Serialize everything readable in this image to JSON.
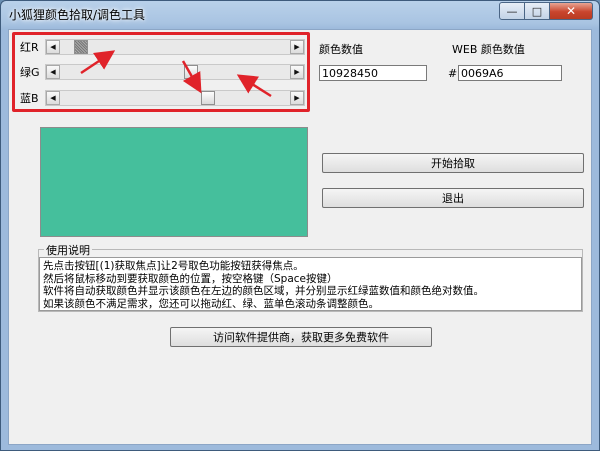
{
  "window": {
    "title": "小狐狸颜色拾取/调色工具",
    "minimize": "—",
    "maximize": "□",
    "close": "✕"
  },
  "sliders": [
    {
      "label": "红R",
      "value": 16,
      "max": 255
    },
    {
      "label": "绿G",
      "value": 146,
      "max": 255
    },
    {
      "label": "蓝B",
      "value": 166,
      "max": 255
    }
  ],
  "fields": {
    "color_value_label": "颜色数值",
    "color_value": "10928450",
    "web_label": "WEB 颜色数值",
    "web_prefix": "#",
    "web_value": "0069A6"
  },
  "buttons": {
    "start_pick": "开始拾取",
    "exit": "退出",
    "visit": "访问软件提供商，获取更多免费软件"
  },
  "usage": {
    "title": "使用说明",
    "lines": [
      "先点击按钮[(1)获取焦点]让2号取色功能按钮获得焦点。",
      "然后将鼠标移动到要获取颜色的位置，按空格键（Space按键）",
      "软件将自动获取颜色并显示该颜色在左边的颜色区域，并分别显示红绿蓝数值和颜色绝对数值。",
      "如果该颜色不满足需求，您还可以拖动红、绿、蓝单色滚动条调整颜色。"
    ]
  },
  "colors": {
    "preview": "#45BF9C",
    "highlight": "#E0232A"
  }
}
